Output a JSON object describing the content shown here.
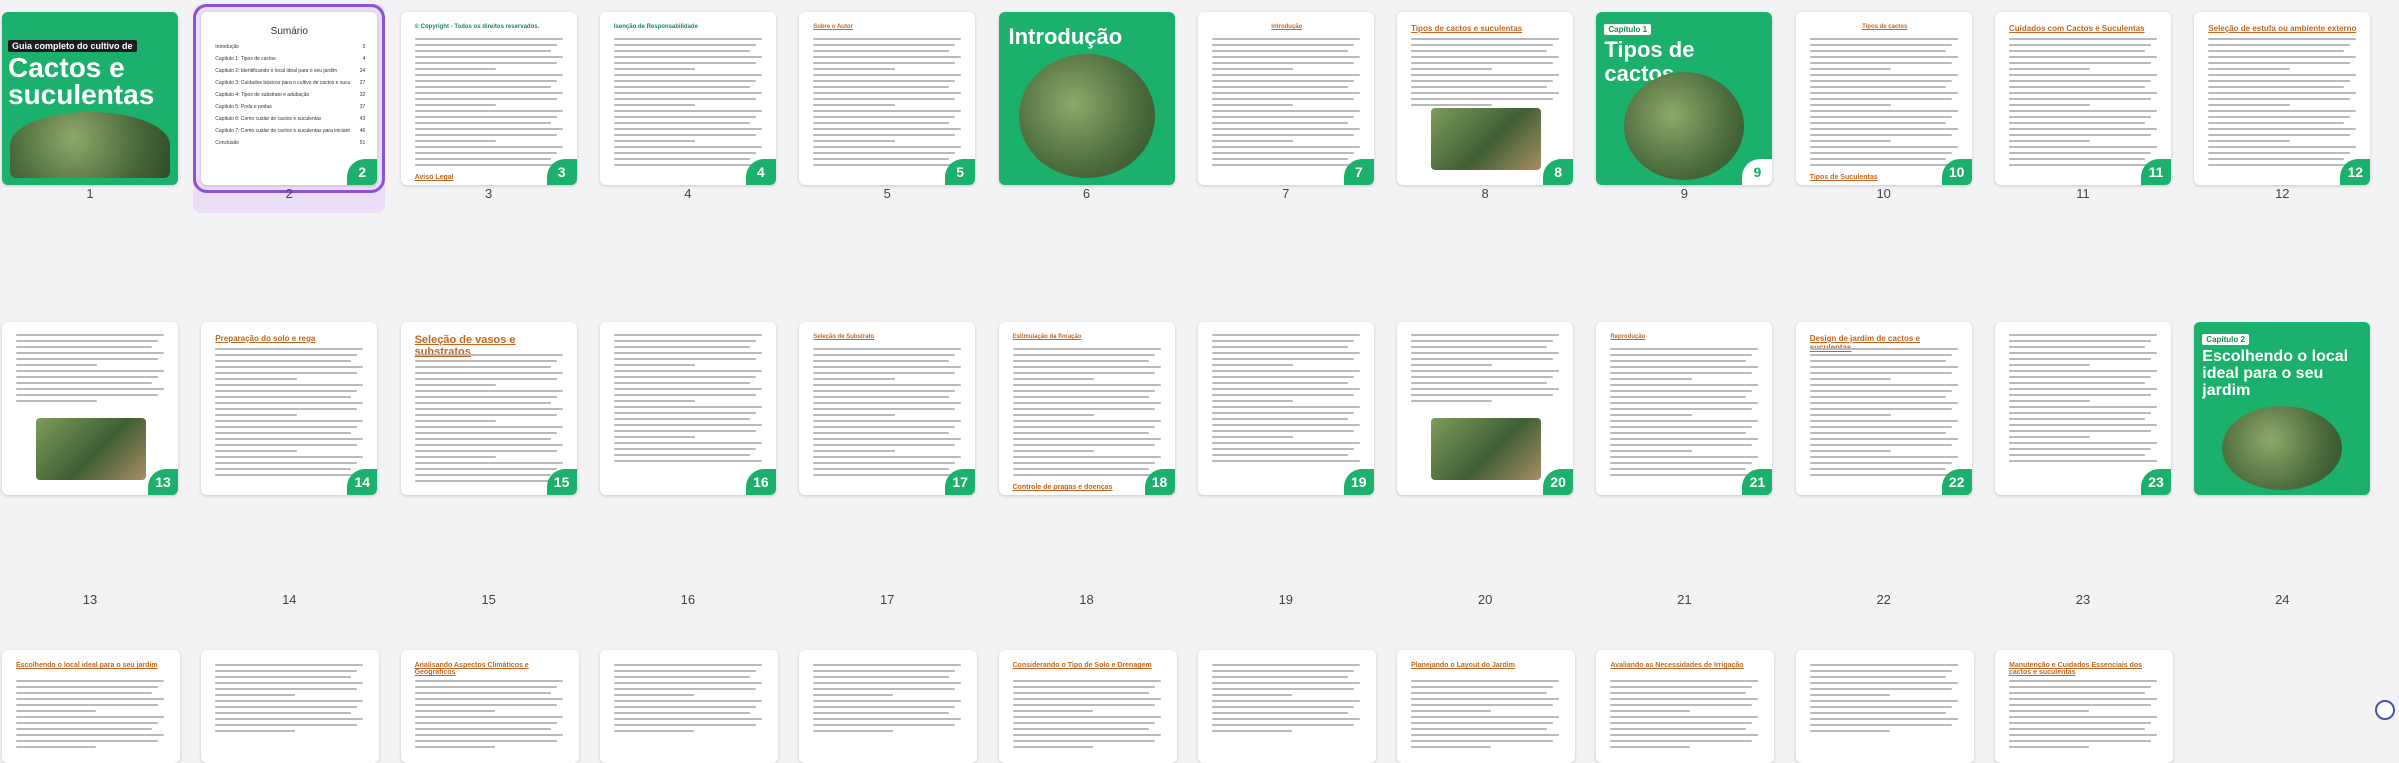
{
  "app": {
    "view": "page-thumbnails",
    "selected_page": "2"
  },
  "pages_row1": [
    {
      "num": "1",
      "badge": "",
      "kind": "cover",
      "label": "Guia completo do cultivo de",
      "title": "Cactos e suculentas"
    },
    {
      "num": "2",
      "badge": "2",
      "kind": "toc",
      "title": "Sumário",
      "toc": [
        {
          "text": "Introdução",
          "page": "3"
        },
        {
          "text": "Capítulo 1: Tipos de cactos",
          "page": "4"
        },
        {
          "text": "Capítulo 2: Identificando o local ideal para o seu jardim",
          "page": "24"
        },
        {
          "text": "Capítulo 3: Cuidados básicos para o cultivo de cactos e suculentas",
          "page": "27"
        },
        {
          "text": "Capítulo 4: Tipos de substrato e adubação",
          "page": "32"
        },
        {
          "text": "Capítulo 5: Poda e podas",
          "page": "37"
        },
        {
          "text": "Capítulo 6: Como cuidar de cactos e suculentas",
          "page": "43"
        },
        {
          "text": "Capítulo 7: Como cuidar de cactos e suculentas para iniciantes",
          "page": "46"
        },
        {
          "text": "Conclusão",
          "page": "51"
        }
      ]
    },
    {
      "num": "3",
      "badge": "3",
      "kind": "text",
      "heading": "© Copyright - Todos os direitos reservados.",
      "heading2": "Aviso Legal"
    },
    {
      "num": "4",
      "badge": "4",
      "kind": "text",
      "heading": "Isenção de Responsabilidade"
    },
    {
      "num": "5",
      "badge": "5",
      "kind": "text",
      "heading": "Sobre o Autor"
    },
    {
      "num": "6",
      "badge": "",
      "kind": "intro",
      "title": "Introdução"
    },
    {
      "num": "7",
      "badge": "7",
      "kind": "text",
      "heading": "Introdução"
    },
    {
      "num": "8",
      "badge": "8",
      "kind": "text-photo",
      "heading": "Tipos de cactos e suculentas"
    },
    {
      "num": "9",
      "badge": "9",
      "kind": "chapter",
      "chip": "Capítulo 1",
      "title": "Tipos de cactos"
    },
    {
      "num": "10",
      "badge": "10",
      "kind": "text",
      "heading": "Tipos de cactos",
      "heading2": "Tipos de Suculentas"
    },
    {
      "num": "11",
      "badge": "11",
      "kind": "text",
      "heading": "Cuidados com Cactos e Suculentas"
    },
    {
      "num": "12",
      "badge": "12",
      "kind": "text",
      "heading": "Seleção de estufa ou ambiente externo"
    }
  ],
  "pages_row2": [
    {
      "num": "13",
      "badge": "13",
      "kind": "text-photo",
      "heading": ""
    },
    {
      "num": "14",
      "badge": "14",
      "kind": "text",
      "heading": "Preparação do solo e rega"
    },
    {
      "num": "15",
      "badge": "15",
      "kind": "text",
      "heading": "Seleção de vasos e substratos"
    },
    {
      "num": "16",
      "badge": "16",
      "kind": "text",
      "heading": ""
    },
    {
      "num": "17",
      "badge": "17",
      "kind": "text",
      "heading": "Seleção de Substrato"
    },
    {
      "num": "18",
      "badge": "18",
      "kind": "text",
      "heading": "Estimulação da floração",
      "heading2": "Controle de pragas e doenças"
    },
    {
      "num": "19",
      "badge": "19",
      "kind": "text",
      "heading": ""
    },
    {
      "num": "20",
      "badge": "20",
      "kind": "text-photo",
      "heading": ""
    },
    {
      "num": "21",
      "badge": "21",
      "kind": "text",
      "heading": "Reprodução"
    },
    {
      "num": "22",
      "badge": "22",
      "kind": "text",
      "heading": "Design de jardim de cactos e suculentas"
    },
    {
      "num": "23",
      "badge": "23",
      "kind": "text",
      "heading": ""
    },
    {
      "num": "24",
      "badge": "",
      "kind": "chapter-photo",
      "chip": "Capítulo 2",
      "title": "Escolhendo o local ideal para o seu jardim"
    }
  ],
  "pages_row3": [
    {
      "heading": "Escolhendo o local ideal para o seu jardim"
    },
    {
      "heading": ""
    },
    {
      "heading": "Analisando Aspectos Climáticos e Geográficos"
    },
    {
      "heading": ""
    },
    {
      "heading": ""
    },
    {
      "heading": "Considerando o Tipo de Solo e Drenagem"
    },
    {
      "heading": ""
    },
    {
      "heading": "Planejando o Layout do Jardim"
    },
    {
      "heading": "Avaliando as Necessidades de Irrigação"
    },
    {
      "heading": ""
    },
    {
      "heading": "Manutenção e Cuidados Essenciais dos cactos e suculentas"
    }
  ],
  "colors": {
    "green": "#1bb06b",
    "accent_selected": "#8a52d8",
    "orange_heading": "#c4661f"
  }
}
